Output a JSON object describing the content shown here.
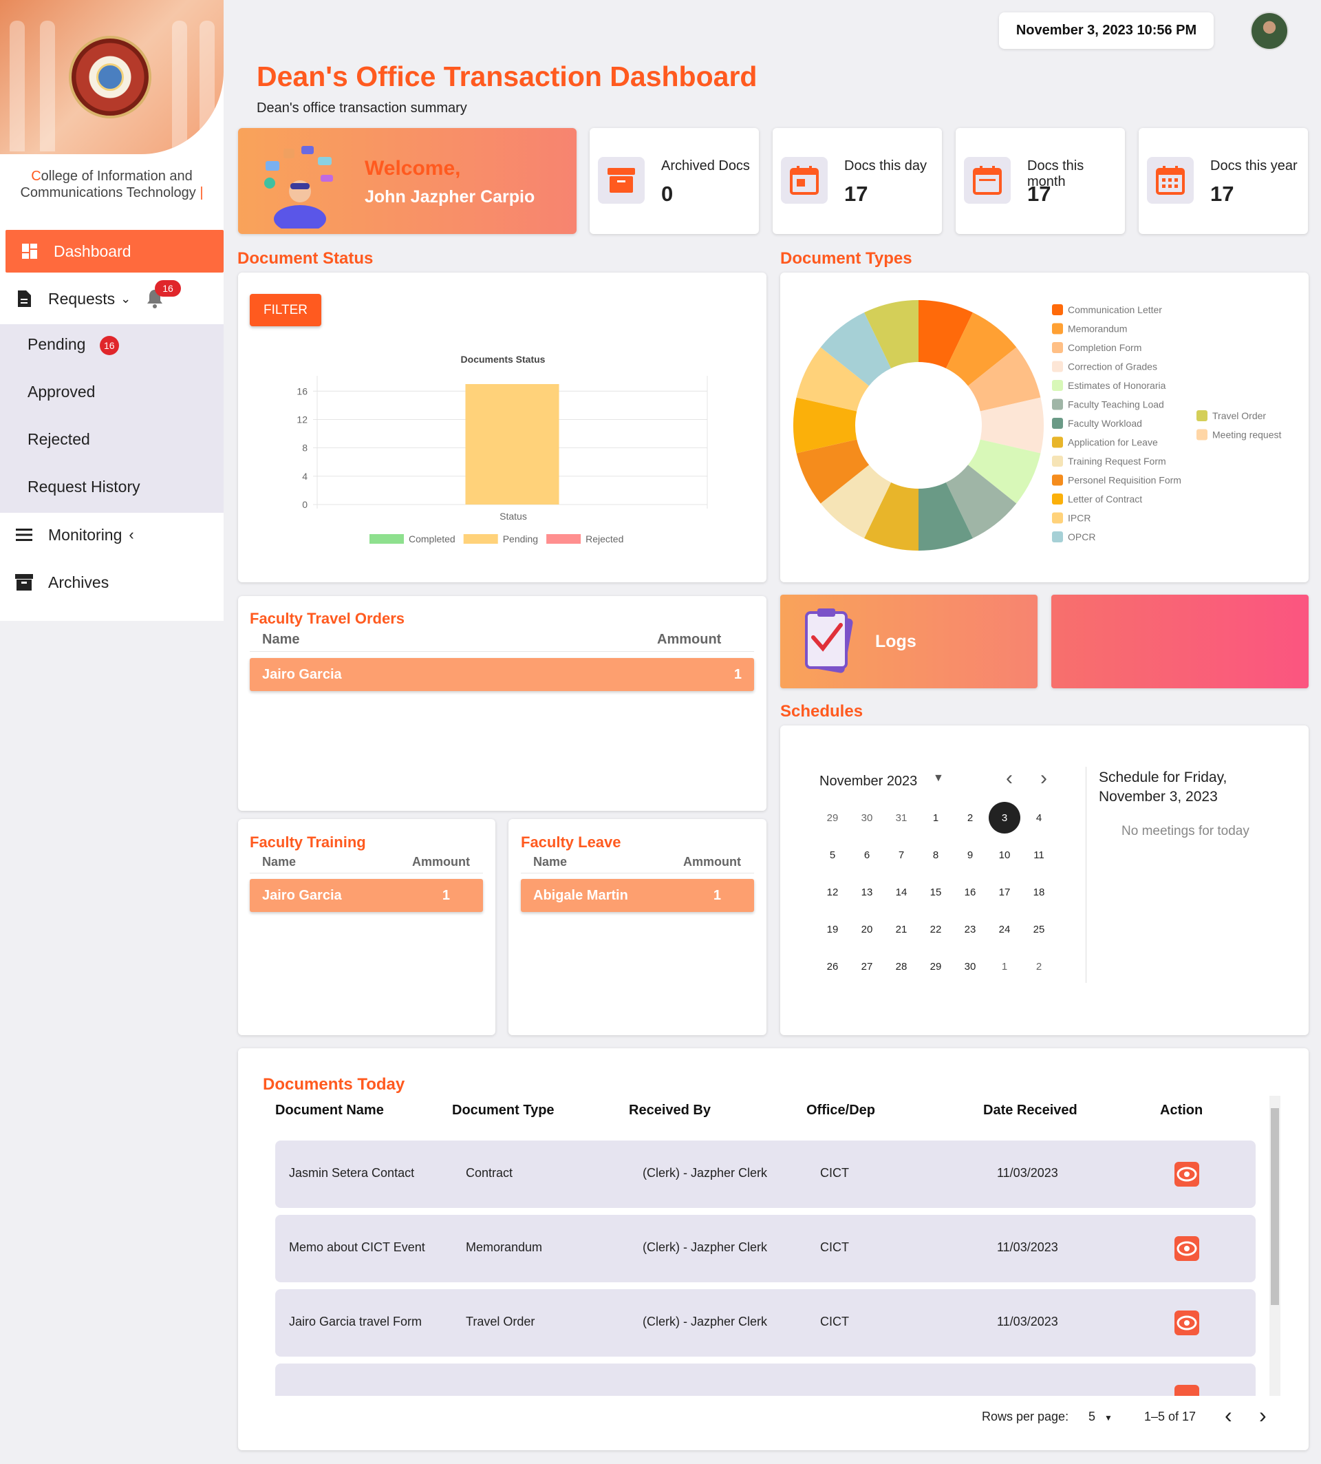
{
  "header": {
    "datetime": "November 3, 2023 10:56 PM",
    "title": "Dean's Office Transaction Dashboard",
    "subtitle": "Dean's office transaction summary"
  },
  "sidebar": {
    "college_first_letter": "C",
    "college_rest_line1": "ollege of Information and",
    "college_line2": "Communications Technology",
    "items": [
      {
        "label": "Dashboard"
      },
      {
        "label": "Requests",
        "badge": "16"
      },
      {
        "label": "Pending",
        "badge": "16"
      },
      {
        "label": "Approved"
      },
      {
        "label": "Rejected"
      },
      {
        "label": "Request History"
      },
      {
        "label": "Monitoring"
      },
      {
        "label": "Archives"
      }
    ]
  },
  "welcome": {
    "greeting": "Welcome,",
    "name": "John Jazpher Carpio"
  },
  "stats": [
    {
      "label": "Archived Docs",
      "value": "0"
    },
    {
      "label": "Docs this day",
      "value": "17"
    },
    {
      "label": "Docs this month",
      "value": "17"
    },
    {
      "label": "Docs this year",
      "value": "17"
    }
  ],
  "document_status": {
    "section_title": "Document Status",
    "filter_label": "FILTER"
  },
  "document_types": {
    "section_title": "Document Types"
  },
  "chart_data": [
    {
      "type": "bar",
      "title": "Documents Status",
      "xlabel": "Status",
      "categories": [
        "Status"
      ],
      "series": [
        {
          "name": "Completed",
          "values": [
            0
          ],
          "color": "#8ee08e"
        },
        {
          "name": "Pending",
          "values": [
            17
          ],
          "color": "#ffd27a"
        },
        {
          "name": "Rejected",
          "values": [
            0
          ],
          "color": "#ff8f8f"
        }
      ],
      "yticks": [
        "0",
        "4",
        "8",
        "12",
        "16"
      ],
      "ylim": [
        0,
        17
      ],
      "grid": true,
      "legend": "bottom"
    },
    {
      "type": "pie",
      "donut": true,
      "legend": "right",
      "slices": [
        {
          "name": "Communication Letter",
          "value": 1,
          "color": "#ff6a0a"
        },
        {
          "name": "Memorandum",
          "value": 1,
          "color": "#ffa033"
        },
        {
          "name": "Completion Form",
          "value": 1,
          "color": "#ffbf85"
        },
        {
          "name": "Correction of Grades",
          "value": 1,
          "color": "#fde6d6"
        },
        {
          "name": "Estimates of Honoraria",
          "value": 1,
          "color": "#d8f8b8"
        },
        {
          "name": "Faculty Teaching Load",
          "value": 1,
          "color": "#9fb5a6"
        },
        {
          "name": "Faculty Workload",
          "value": 1,
          "color": "#6a9a86"
        },
        {
          "name": "Application for Leave",
          "value": 1,
          "color": "#e8b52a"
        },
        {
          "name": "Training Request Form",
          "value": 1,
          "color": "#f6e4b6"
        },
        {
          "name": "Personel Requisition Form",
          "value": 1,
          "color": "#f58c1c"
        },
        {
          "name": "Letter of Contract",
          "value": 1,
          "color": "#fbb00a"
        },
        {
          "name": "IPCR",
          "value": 1,
          "color": "#ffd27a"
        },
        {
          "name": "OPCR",
          "value": 1,
          "color": "#a6d0d6"
        },
        {
          "name": "Travel Order",
          "value": 1,
          "color": "#d4cf58"
        },
        {
          "name": "Meeting request",
          "value": 0,
          "color": "#ffd6a6"
        }
      ]
    }
  ],
  "travel_orders": {
    "title": "Faculty Travel Orders",
    "col_name": "Name",
    "col_amount": "Ammount",
    "rows": [
      {
        "name": "Jairo Garcia",
        "amount": "1"
      }
    ]
  },
  "training": {
    "title": "Faculty Training",
    "col_name": "Name",
    "col_amount": "Ammount",
    "rows": [
      {
        "name": "Jairo Garcia",
        "amount": "1"
      }
    ]
  },
  "leave": {
    "title": "Faculty Leave",
    "col_name": "Name",
    "col_amount": "Ammount",
    "rows": [
      {
        "name": "Abigale Martin",
        "amount": "1"
      }
    ]
  },
  "logs": {
    "label": "Logs"
  },
  "schedules": {
    "title": "Schedules",
    "month_label": "November 2023",
    "schedule_heading_line1": "Schedule for Friday,",
    "schedule_heading_line2": "November 3, 2023",
    "no_meetings": "No meetings for today",
    "weeks": [
      [
        "29",
        "30",
        "31",
        "1",
        "2",
        "3",
        "4"
      ],
      [
        "5",
        "6",
        "7",
        "8",
        "9",
        "10",
        "11"
      ],
      [
        "12",
        "13",
        "14",
        "15",
        "16",
        "17",
        "18"
      ],
      [
        "19",
        "20",
        "21",
        "22",
        "23",
        "24",
        "25"
      ],
      [
        "26",
        "27",
        "28",
        "29",
        "30",
        "1",
        "2"
      ]
    ],
    "selected": "3"
  },
  "documents_today": {
    "title": "Documents Today",
    "columns": [
      "Document Name",
      "Document Type",
      "Received By",
      "Office/Dep",
      "Date Received",
      "Action"
    ],
    "rows": [
      [
        "Jasmin Setera Contact",
        "Contract",
        "(Clerk) - Jazpher Clerk",
        "CICT",
        "11/03/2023"
      ],
      [
        "Memo about CICT Event",
        "Memorandum",
        "(Clerk) - Jazpher Clerk",
        "CICT",
        "11/03/2023"
      ],
      [
        "Jairo Garcia travel Form",
        "Travel Order",
        "(Clerk) - Jazpher Clerk",
        "CICT",
        "11/03/2023"
      ]
    ],
    "rows_per_page_label": "Rows per page:",
    "rows_per_page": "5",
    "range": "1–5 of 17"
  }
}
